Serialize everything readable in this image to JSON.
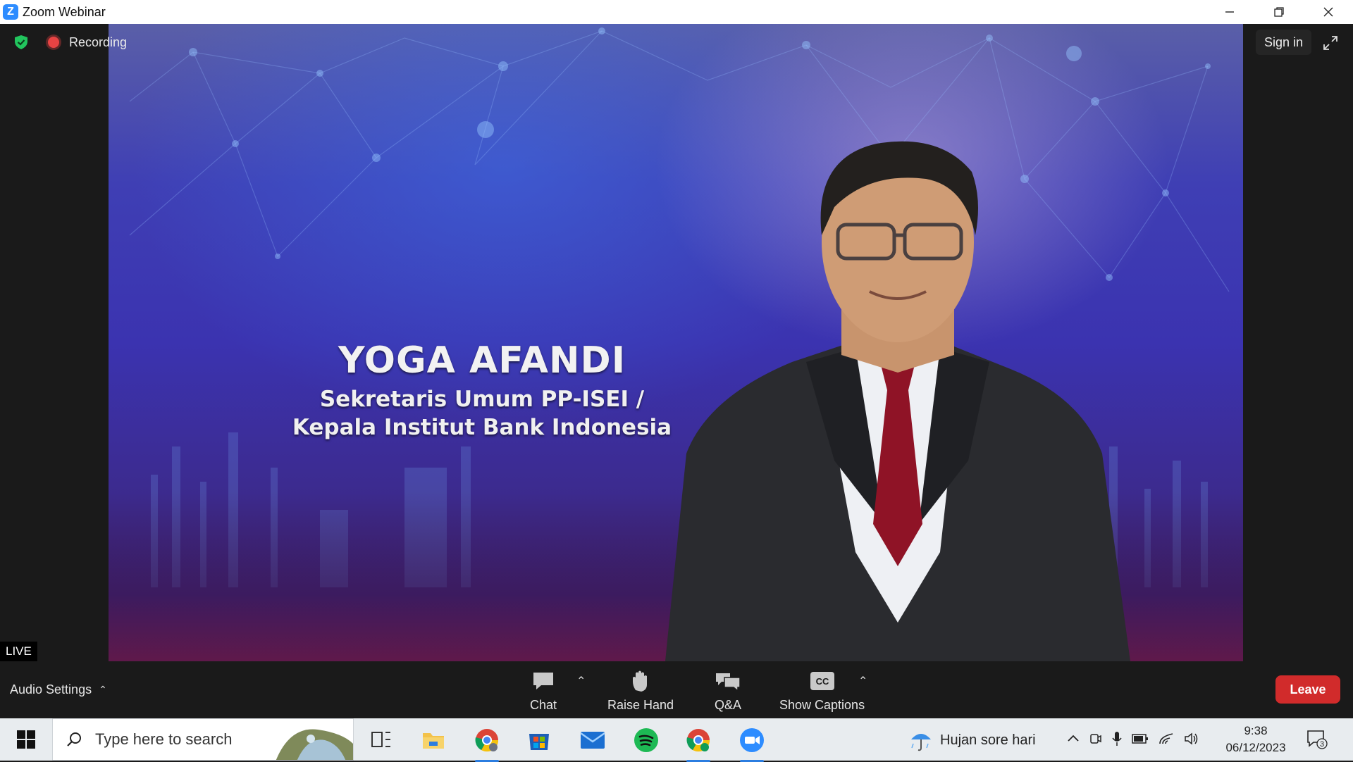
{
  "window": {
    "title": "Zoom Webinar",
    "controls": [
      "minimize",
      "restore",
      "close"
    ]
  },
  "topbar": {
    "recording_label": "Recording",
    "signin_label": "Sign in"
  },
  "video": {
    "speaker_name": "YOGA AFANDI",
    "speaker_role_line1": "Sekretaris Umum PP-ISEI /",
    "speaker_role_line2": "Kepala Institut Bank Indonesia",
    "live_label": "LIVE"
  },
  "controls": {
    "audio_settings": "Audio Settings",
    "chat": "Chat",
    "raise_hand": "Raise Hand",
    "qa": "Q&A",
    "captions": "Show Captions",
    "captions_badge": "CC",
    "leave": "Leave"
  },
  "taskbar": {
    "search_placeholder": "Type here to search",
    "weather": "Hujan sore hari",
    "time": "9:38",
    "date": "06/12/2023",
    "notifications_count": "3",
    "apps": [
      "task-view",
      "file-explorer",
      "chrome",
      "microsoft-store",
      "mail",
      "spotify",
      "chrome-profile",
      "zoom"
    ]
  },
  "colors": {
    "leave": "#d12b2b",
    "zoom_blue": "#2d8cff",
    "recording": "#e84343",
    "shield": "#22c55e"
  }
}
